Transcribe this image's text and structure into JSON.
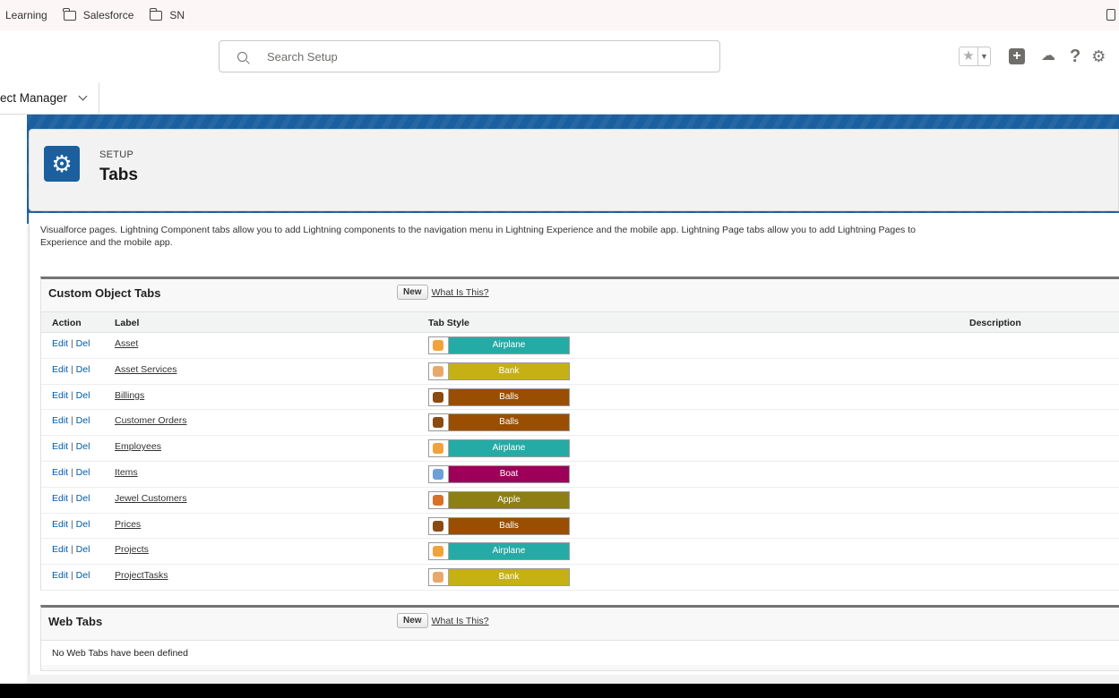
{
  "bookmarks": {
    "items": [
      {
        "label": "Learning",
        "folder": false
      },
      {
        "label": "Salesforce",
        "folder": true
      },
      {
        "label": "SN",
        "folder": true
      }
    ]
  },
  "header": {
    "search_placeholder": "Search Setup",
    "icons": [
      "favorites-star-icon",
      "add-plus-icon",
      "trailhead-icon",
      "help-icon",
      "setup-gear-icon"
    ],
    "help_glyph": "?"
  },
  "appnav": {
    "object_manager_label": "ect Manager"
  },
  "setup": {
    "small_label": "SETUP",
    "title": "Tabs"
  },
  "intro_lines": [
    "Visualforce pages. Lightning Component tabs allow you to add Lightning components to the navigation menu in Lightning Experience and the mobile app. Lightning Page tabs allow you to add Lightning Pages to",
    "Experience and the mobile app."
  ],
  "custom_object_tabs": {
    "title": "Custom Object Tabs",
    "new_label": "New",
    "what_is_this": "What Is This?",
    "columns": [
      "Action",
      "Label",
      "Tab Style",
      "Description"
    ],
    "edit_label": "Edit",
    "del_label": "Del",
    "separator": " | ",
    "rows": [
      {
        "label": "Asset",
        "style": "Airplane",
        "color": "#25aba6",
        "icon_color": "#f2a23a"
      },
      {
        "label": "Asset Services",
        "style": "Bank",
        "color": "#c6b114",
        "icon_color": "#e8a86a"
      },
      {
        "label": "Billings",
        "style": "Balls",
        "color": "#994e02",
        "icon_color": "#8a4a12"
      },
      {
        "label": "Customer Orders",
        "style": "Balls",
        "color": "#994e02",
        "icon_color": "#8a4a12"
      },
      {
        "label": "Employees",
        "style": "Airplane",
        "color": "#25aba6",
        "icon_color": "#f2a23a"
      },
      {
        "label": "Items",
        "style": "Boat",
        "color": "#9c0059",
        "icon_color": "#6f9fd6"
      },
      {
        "label": "Jewel Customers",
        "style": "Apple",
        "color": "#8d7f14",
        "icon_color": "#d9702a"
      },
      {
        "label": "Prices",
        "style": "Balls",
        "color": "#994e02",
        "icon_color": "#8a4a12"
      },
      {
        "label": "Projects",
        "style": "Airplane",
        "color": "#25aba6",
        "icon_color": "#f2a23a"
      },
      {
        "label": "ProjectTasks",
        "style": "Bank",
        "color": "#c6b114",
        "icon_color": "#e8a86a"
      }
    ]
  },
  "web_tabs": {
    "title": "Web Tabs",
    "new_label": "New",
    "what_is_this": "What Is This?",
    "empty_message": "No Web Tabs have been defined"
  },
  "colors": {
    "brand_band": "#1b5f9e",
    "link": "#015ba7"
  }
}
